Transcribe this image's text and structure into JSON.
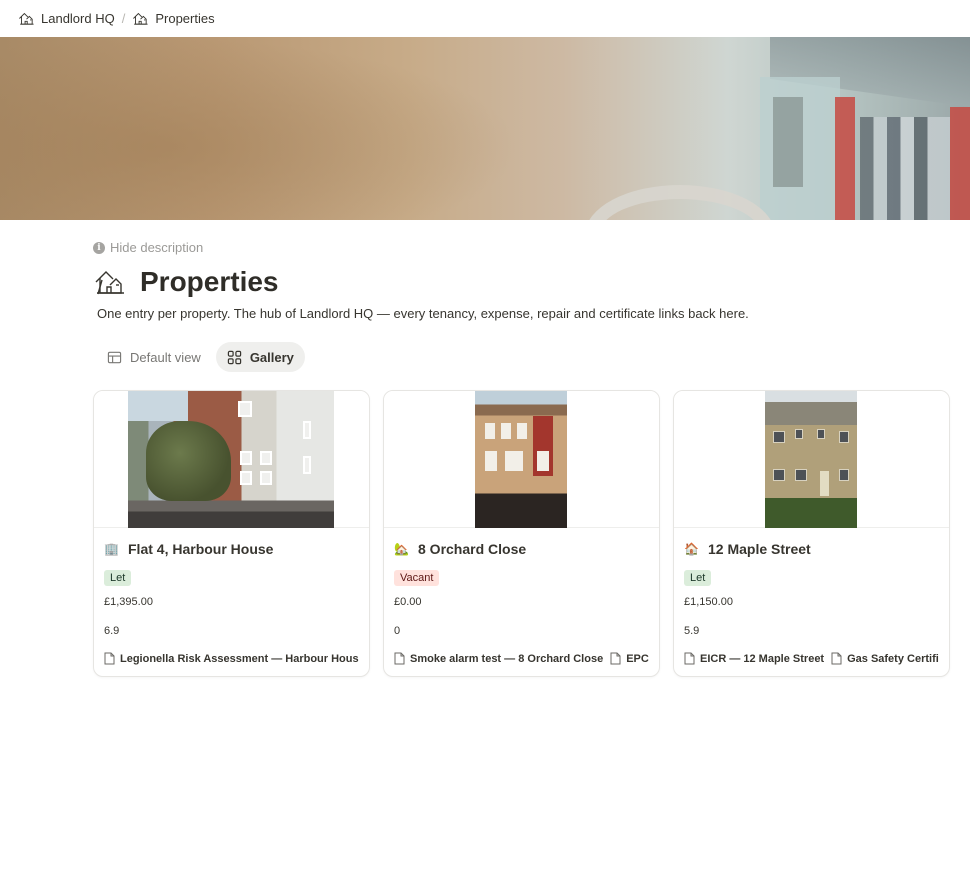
{
  "breadcrumb": {
    "items": [
      {
        "label": "Landlord HQ",
        "icon": "house-sketch-icon"
      },
      {
        "label": "Properties",
        "icon": "house-sketch-icon"
      }
    ],
    "separator": "/"
  },
  "page": {
    "hide_description_label": "Hide description",
    "title": "Properties",
    "description": "One entry per property. The hub of Landlord HQ — every tenancy, expense, repair and certificate links back here."
  },
  "views": [
    {
      "label": "Default view",
      "icon": "table-icon",
      "active": false
    },
    {
      "label": "Gallery",
      "icon": "gallery-icon",
      "active": true
    }
  ],
  "cards": [
    {
      "title": "Flat 4, Harbour House",
      "icon": "office-building-icon",
      "status": "Let",
      "rent": "£1,395.00",
      "score": "6.9",
      "relations": [
        "Legionella Risk Assessment — Harbour House",
        ""
      ]
    },
    {
      "title": "8 Orchard Close",
      "icon": "house-with-garden-icon",
      "status": "Vacant",
      "rent": "£0.00",
      "score": "0",
      "relations": [
        "Smoke alarm test — 8 Orchard Close",
        "EPC —"
      ]
    },
    {
      "title": "12 Maple Street",
      "icon": "house-icon",
      "status": "Let",
      "rent": "£1,150.00",
      "score": "5.9",
      "relations": [
        "EICR — 12 Maple Street",
        "Gas Safety Certificate"
      ]
    }
  ],
  "colors": {
    "let_badge_bg": "#dbeddb",
    "vacant_badge_bg": "#ffe2dd",
    "active_tab_bg": "#efefed"
  }
}
